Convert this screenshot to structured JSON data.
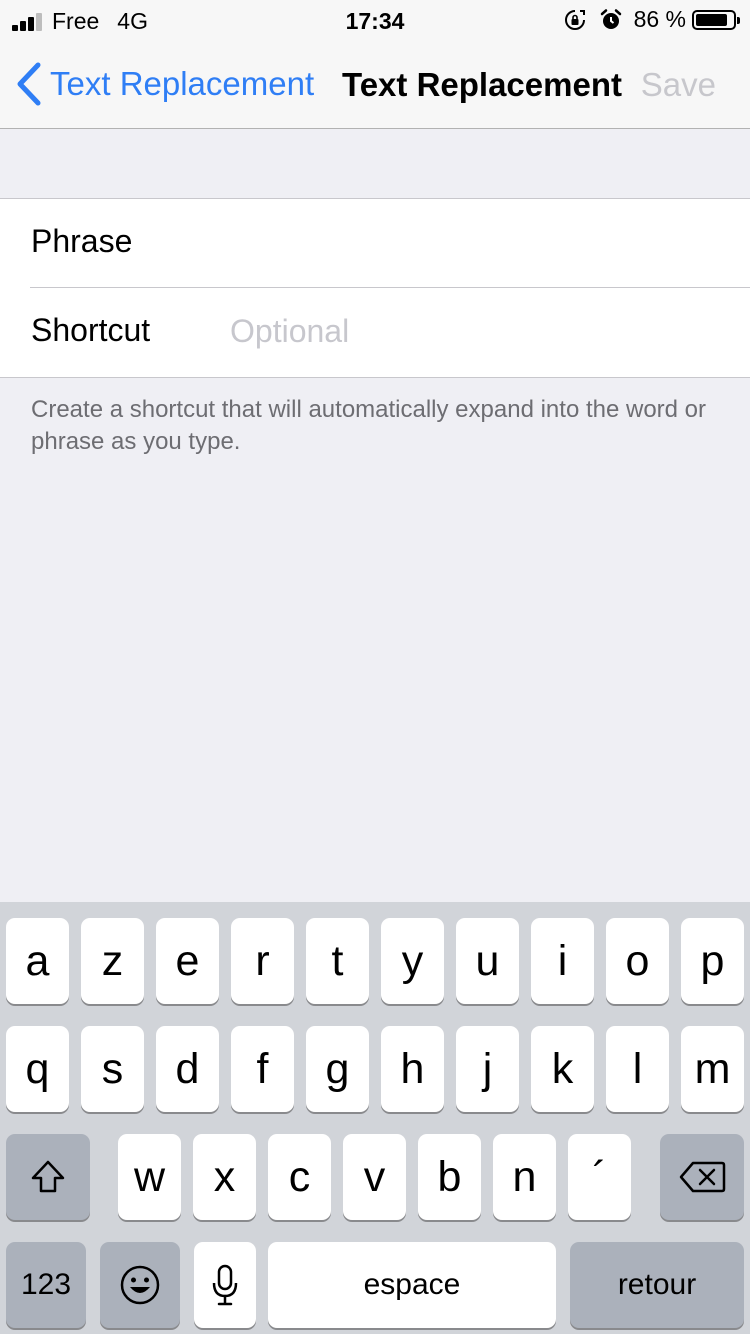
{
  "status_bar": {
    "carrier": "Free",
    "network": "4G",
    "time": "17:34",
    "battery_percent": "86 %",
    "battery_level": 0.86,
    "icons": [
      "signal-icon",
      "rotation-lock-icon",
      "alarm-icon",
      "battery-icon"
    ]
  },
  "nav": {
    "back_label": "Text Replacement",
    "title": "Text Replacement",
    "save_label": "Save"
  },
  "form": {
    "phrase_label": "Phrase",
    "phrase_value": "",
    "shortcut_label": "Shortcut",
    "shortcut_placeholder": "Optional",
    "shortcut_value": ""
  },
  "footnote": "Create a shortcut that will automatically expand into the word or phrase as you type.",
  "keyboard": {
    "row1": [
      "a",
      "z",
      "e",
      "r",
      "t",
      "y",
      "u",
      "i",
      "o",
      "p"
    ],
    "row2": [
      "q",
      "s",
      "d",
      "f",
      "g",
      "h",
      "j",
      "k",
      "l",
      "m"
    ],
    "row3": [
      "w",
      "x",
      "c",
      "v",
      "b",
      "n",
      "´"
    ],
    "numbers_label": "123",
    "space_label": "espace",
    "return_label": "retour"
  },
  "colors": {
    "accent": "#2f7ef5",
    "disabled": "#c7c7cc",
    "background": "#efeff4",
    "keyboard_bg": "#d1d4d9",
    "dark_key": "#abb1bb"
  }
}
